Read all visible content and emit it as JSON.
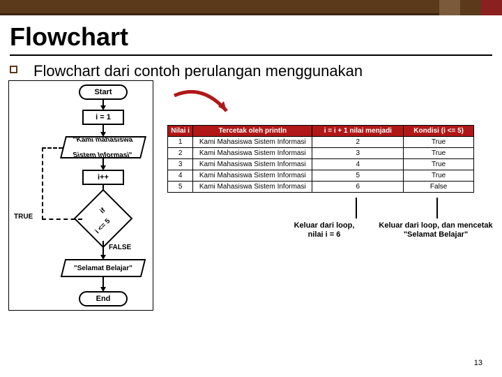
{
  "title": "Flowchart",
  "bullet_text": "Flowchart dari contoh perulangan menggunakan",
  "flow": {
    "start": "Start",
    "init": "i = 1",
    "print1_l1": "\"Kami mahasiswa",
    "print1_l2": "Sistem Informasi\"",
    "inc": "i++",
    "cond_l1": "if",
    "cond_l2": "i <= 5",
    "true_label": "TRUE",
    "false_label": "FALSE",
    "print2": "\"Selamat Belajar\"",
    "end": "End"
  },
  "table": {
    "headers": [
      "Nilai i",
      "Tercetak oleh println",
      "i = i + 1 nilai menjadi",
      "Kondisi (i <= 5)"
    ],
    "rows": [
      [
        "1",
        "Kami Mahasiswa Sistem Informasi",
        "2",
        "True"
      ],
      [
        "2",
        "Kami Mahasiswa Sistem Informasi",
        "3",
        "True"
      ],
      [
        "3",
        "Kami Mahasiswa Sistem Informasi",
        "4",
        "True"
      ],
      [
        "4",
        "Kami Mahasiswa Sistem Informasi",
        "5",
        "True"
      ],
      [
        "5",
        "Kami Mahasiswa Sistem Informasi",
        "6",
        "False"
      ]
    ]
  },
  "anno1_l1": "Keluar dari loop,",
  "anno1_l2": "nilai i = 6",
  "anno2_l1": "Keluar dari loop, dan mencetak",
  "anno2_l2": "\"Selamat Belajar\"",
  "slide_number": "13"
}
